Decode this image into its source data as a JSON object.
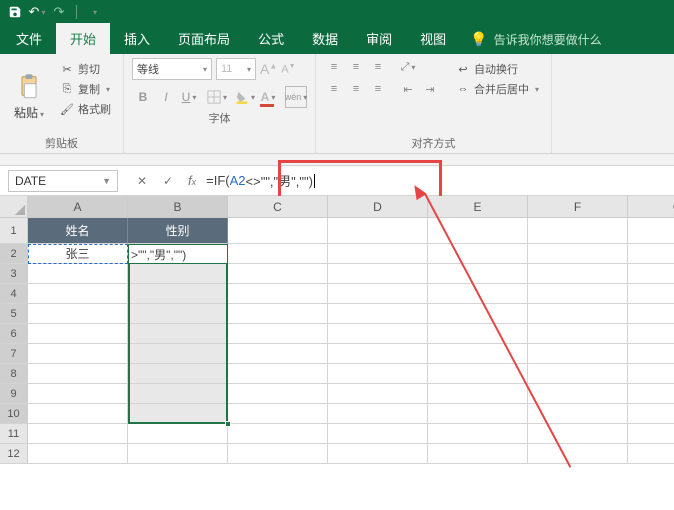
{
  "titlebar": {
    "save_tip": "保存",
    "undo_tip": "撤销",
    "redo_tip": "重做"
  },
  "tabs": {
    "file": "文件",
    "home": "开始",
    "insert": "插入",
    "layout": "页面布局",
    "formula": "公式",
    "data": "数据",
    "review": "审阅",
    "view": "视图",
    "tell_me": "告诉我你想要做什么"
  },
  "ribbon": {
    "clipboard": {
      "paste": "粘贴",
      "cut": "剪切",
      "copy": "复制",
      "format_painter": "格式刷",
      "label": "剪贴板"
    },
    "font": {
      "name": "等线",
      "size": "11",
      "increase": "A",
      "decrease": "A",
      "label": "字体"
    },
    "align": {
      "wrap": "自动换行",
      "merge": "合并后居中",
      "label": "对齐方式"
    }
  },
  "fx": {
    "name_box": "DATE",
    "formula_prefix": "=IF(",
    "formula_ref": "A2",
    "formula_rest": "<>\"\",\"男\",\"\")"
  },
  "sheet": {
    "cols": [
      "A",
      "B",
      "C",
      "D",
      "E",
      "F",
      "G"
    ],
    "rows": [
      "1",
      "2",
      "3",
      "4",
      "5",
      "6",
      "7",
      "8",
      "9",
      "10",
      "11",
      "12"
    ],
    "header_row": {
      "name": "姓名",
      "gender": "性别"
    },
    "a2": "张三",
    "b2_display": ">\"\",\"男\",\"\")"
  }
}
